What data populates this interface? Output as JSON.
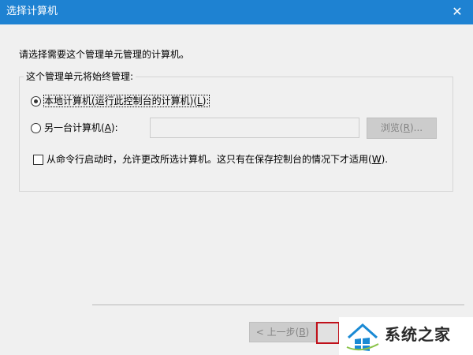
{
  "window": {
    "title": "选择计算机",
    "close_glyph": "✕"
  },
  "prompt": "请选择需要这个管理单元管理的计算机。",
  "group": {
    "title": "这个管理单元将始终管理:",
    "local_option": {
      "label_before": "本地计算机(运行此控制台的计算机)(",
      "accel": "L",
      "label_after": "):",
      "selected": true
    },
    "remote_option": {
      "label_before": "另一台计算机(",
      "accel": "A",
      "label_after": "):",
      "selected": false
    },
    "remote_input": {
      "value": "",
      "placeholder": ""
    },
    "browse_button": {
      "label_before": "浏览(",
      "accel": "R",
      "label_after": ")..."
    },
    "checkbox": {
      "label_before": "从命令行启动时，允许更改所选计算机。这只有在保存控制台的情况下才适用(",
      "accel": "W",
      "label_after": ").",
      "checked": false
    }
  },
  "footer": {
    "back_button": {
      "label_before": "< 上一步(",
      "accel": "B",
      "label_after": ")"
    }
  },
  "watermark": {
    "text": "系统之家",
    "logo_icon": "windows-house-logo-icon"
  },
  "colors": {
    "titlebar": "#1e82d2",
    "dialog_bg": "#f0f0f0",
    "disabled_button": "#cccccc",
    "focus_highlight": "#c0101a"
  }
}
